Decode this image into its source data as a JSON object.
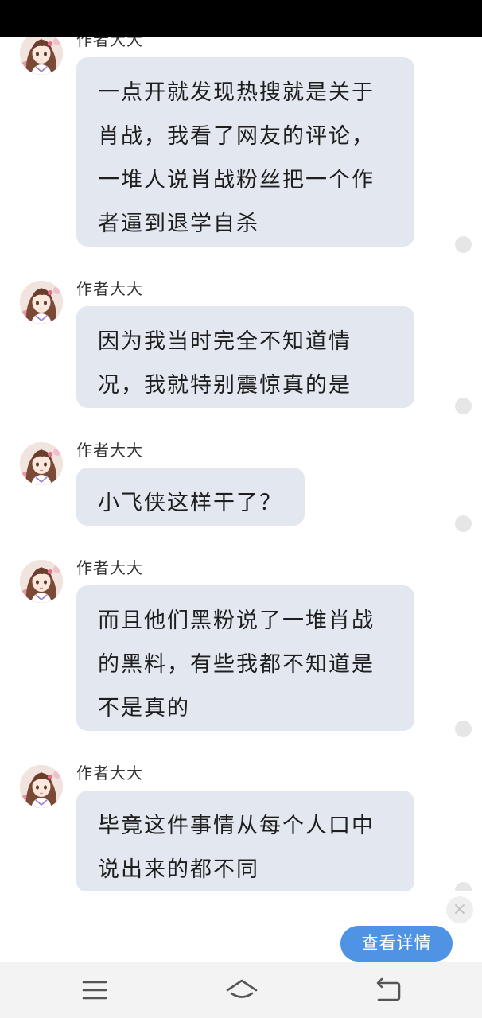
{
  "messages": [
    {
      "sender": "作者大大",
      "lines": [
        "一点开就发现热搜就是关于",
        "肖战，我看了网友的评论，",
        "一堆人说肖战粉丝把一个作",
        "者逼到退学自杀"
      ]
    },
    {
      "sender": "作者大大",
      "lines": [
        "因为我当时完全不知道情",
        "况，我就特别震惊真的是"
      ]
    },
    {
      "sender": "作者大大",
      "lines": [
        "小飞侠这样干了？"
      ]
    },
    {
      "sender": "作者大大",
      "lines": [
        "而且他们黑粉说了一堆肖战",
        "的黑料，有些我都不知道是",
        "不是真的"
      ]
    },
    {
      "sender": "作者大大",
      "lines": [
        "毕竟这件事情从每个人口中",
        "说出来的都不同"
      ]
    }
  ],
  "overlay": {
    "detail_button_label": "查看详情",
    "close_icon": "×"
  },
  "nav": {
    "icons": [
      "menu-icon",
      "home-icon",
      "back-icon"
    ]
  },
  "colors": {
    "bubble": "#e3e8f0",
    "button": "#4f93e4",
    "status_bar": "#000000",
    "nav_bar": "#f3f3f3"
  }
}
